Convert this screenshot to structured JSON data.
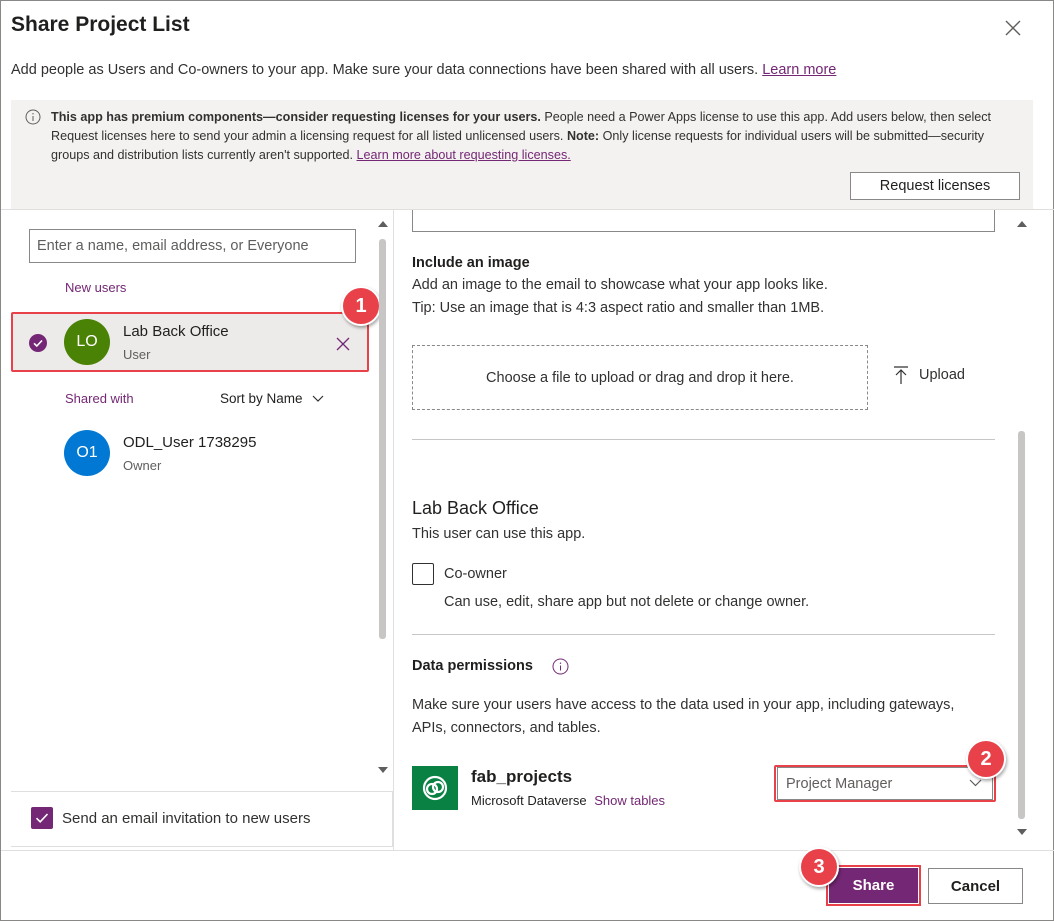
{
  "dialog": {
    "title": "Share Project List",
    "subtitle": "Add people as Users and Co-owners to your app. Make sure your data connections have been shared with all users.",
    "learn_more": "Learn more"
  },
  "notice": {
    "bold": "This app has premium components—consider requesting licenses for your users.",
    "text1": " People need a Power Apps license to use this app. Add users below, then select Request licenses here to send your admin a licensing request for all listed unlicensed users. ",
    "note_label": "Note:",
    "text2": " Only license requests for individual users will be submitted—security groups and distribution lists currently aren't supported. ",
    "link": "Learn more about requesting licenses.",
    "request_button": "Request licenses"
  },
  "left_panel": {
    "search_placeholder": "Enter a name, email address, or Everyone",
    "new_users_label": "New users",
    "new_user": {
      "initials": "LO",
      "name": "Lab Back Office",
      "role": "User",
      "avatar_color": "#498205"
    },
    "shared_with_label": "Shared with",
    "sort_label": "Sort by Name",
    "shared_user": {
      "initials": "O1",
      "name": "ODL_User 1738295",
      "role": "Owner",
      "avatar_color": "#0078d4"
    },
    "email_invite_label": "Send an email invitation to new users"
  },
  "right_panel": {
    "image_heading": "Include an image",
    "image_desc": "Add an image to the email to showcase what your app looks like.",
    "image_tip": "Tip: Use an image that is 4:3 aspect ratio and smaller than 1MB.",
    "drop_text": "Choose a file to upload or drag and drop it here.",
    "upload_label": "Upload",
    "user_heading": "Lab Back Office",
    "user_desc": "This user can use this app.",
    "coowner_label": "Co-owner",
    "coowner_desc": "Can use, edit, share app but not delete or change owner.",
    "data_perm_heading": "Data permissions",
    "data_perm_desc_1": "Make sure your users have access to the data used in your app, including gateways,",
    "data_perm_desc_2": "APIs, connectors, and tables.",
    "table_name": "fab_projects",
    "table_source": "Microsoft Dataverse",
    "show_tables": "Show tables",
    "role_value": "Project Manager"
  },
  "footer": {
    "share_button": "Share",
    "cancel_button": "Cancel"
  },
  "badges": {
    "one": "1",
    "two": "2",
    "three": "3"
  },
  "colors": {
    "accent": "#742774",
    "highlight": "#e8414a",
    "dataverse": "#088142"
  }
}
